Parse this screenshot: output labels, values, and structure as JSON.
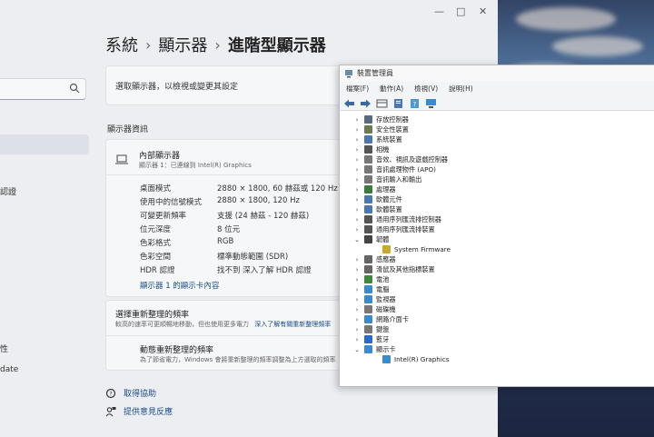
{
  "settings": {
    "breadcrumb": [
      "系統",
      "顯示器",
      "進階型顯示器"
    ],
    "sidebar_fragments": [
      "認證",
      "性",
      "date"
    ],
    "select_display_label": "選取顯示器，以檢視或變更其設定",
    "section_title": "顯示器資訊",
    "monitor": {
      "name": "內部顯示器",
      "sub": "顯示器 1：已連線到 Intel(R) Graphics"
    },
    "properties": [
      {
        "label": "桌面模式",
        "value": "2880 × 1800, 60 赫茲或 120 Hz"
      },
      {
        "label": "使用中的信號模式",
        "value": "2880 × 1800, 120 Hz"
      },
      {
        "label": "可變更新頻率",
        "value": "支援 (24 赫茲 - 120 赫茲)"
      },
      {
        "label": "位元深度",
        "value": "8 位元"
      },
      {
        "label": "色彩格式",
        "value": "RGB"
      },
      {
        "label": "色彩空間",
        "value": "標準動態範圍 (SDR)"
      },
      {
        "label": "HDR 認證",
        "value": "找不到 深入了解 HDR 認證"
      }
    ],
    "adapter_link": "顯示器 1 的顯示卡內容",
    "refresh": {
      "title": "選擇重新整理的頻率",
      "desc": "較高的速率可更順暢地移動，但也使用更多電力",
      "desc_link": "深入了解有關重新整理頻率",
      "dynamic_title": "動態重新整理的頻率",
      "dynamic_desc": "為了節省電力，Windows 會將重新整理的頻率調整為上方選取的頻率"
    },
    "help": [
      "取得協助",
      "提供意見反應"
    ]
  },
  "devmgr": {
    "title": "裝置管理員",
    "menu": [
      "檔案(F)",
      "動作(A)",
      "檢視(V)",
      "說明(H)"
    ],
    "tree": [
      {
        "label": "存放控制器",
        "state": "collapsed",
        "indent": 0,
        "color": "#5a6a80"
      },
      {
        "label": "安全性裝置",
        "state": "collapsed",
        "indent": 0,
        "color": "#6a7a50"
      },
      {
        "label": "系統裝置",
        "state": "collapsed",
        "indent": 0,
        "color": "#4a78b0"
      },
      {
        "label": "相機",
        "state": "collapsed",
        "indent": 0,
        "color": "#555555"
      },
      {
        "label": "音效、視訊及遊戲控制器",
        "state": "collapsed",
        "indent": 0,
        "color": "#777777"
      },
      {
        "label": "音訊處理物件 (APO)",
        "state": "collapsed",
        "indent": 0,
        "color": "#777777"
      },
      {
        "label": "音訊輸入和輸出",
        "state": "collapsed",
        "indent": 0,
        "color": "#777777"
      },
      {
        "label": "處理器",
        "state": "collapsed",
        "indent": 0,
        "color": "#3d7a3d"
      },
      {
        "label": "軟體元件",
        "state": "collapsed",
        "indent": 0,
        "color": "#4a78b0"
      },
      {
        "label": "軟體裝置",
        "state": "collapsed",
        "indent": 0,
        "color": "#4a78b0"
      },
      {
        "label": "通用序列匯流排控制器",
        "state": "collapsed",
        "indent": 0,
        "color": "#555555"
      },
      {
        "label": "通用序列匯流排裝置",
        "state": "collapsed",
        "indent": 0,
        "color": "#555555"
      },
      {
        "label": "韌體",
        "state": "expanded",
        "indent": 0,
        "color": "#444444"
      },
      {
        "label": "System Firmware",
        "state": "leaf",
        "indent": 1,
        "color": "#c9a830"
      },
      {
        "label": "感應器",
        "state": "collapsed",
        "indent": 0,
        "color": "#666666"
      },
      {
        "label": "滑鼠及其他指標裝置",
        "state": "collapsed",
        "indent": 0,
        "color": "#666666"
      },
      {
        "label": "電池",
        "state": "collapsed",
        "indent": 0,
        "color": "#3d8a3d"
      },
      {
        "label": "電腦",
        "state": "collapsed",
        "indent": 0,
        "color": "#3a8ad0"
      },
      {
        "label": "監視器",
        "state": "collapsed",
        "indent": 0,
        "color": "#3a8ad0"
      },
      {
        "label": "磁碟機",
        "state": "collapsed",
        "indent": 0,
        "color": "#777777"
      },
      {
        "label": "網路介面卡",
        "state": "collapsed",
        "indent": 0,
        "color": "#3a8ad0"
      },
      {
        "label": "鍵盤",
        "state": "collapsed",
        "indent": 0,
        "color": "#777777"
      },
      {
        "label": "藍牙",
        "state": "collapsed",
        "indent": 0,
        "color": "#2a6ad0"
      },
      {
        "label": "顯示卡",
        "state": "expanded",
        "indent": 0,
        "color": "#3a8ad0"
      },
      {
        "label": "Intel(R) Graphics",
        "state": "leaf",
        "indent": 1,
        "color": "#3a8ad0"
      }
    ]
  }
}
